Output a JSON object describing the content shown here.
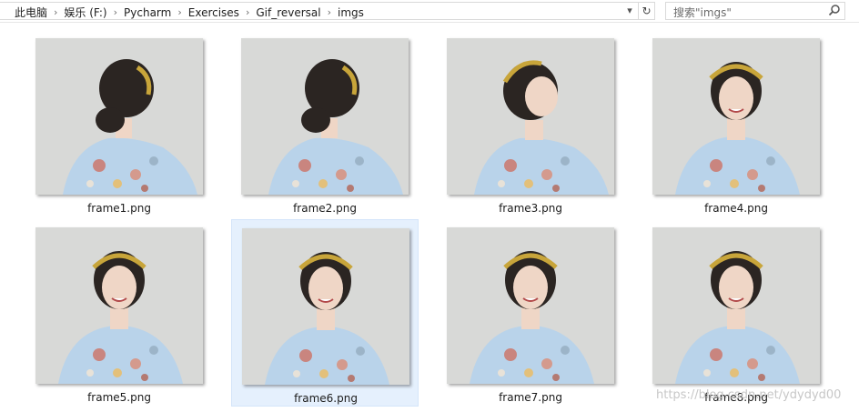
{
  "breadcrumbs": [
    "此电脑",
    "娱乐 (F:)",
    "Pycharm",
    "Exercises",
    "Gif_reversal",
    "imgs"
  ],
  "search": {
    "placeholder": "搜索\"imgs\""
  },
  "files": [
    {
      "name": "frame1.png",
      "pose": "back",
      "selected": false
    },
    {
      "name": "frame2.png",
      "pose": "back",
      "selected": false
    },
    {
      "name": "frame3.png",
      "pose": "turn",
      "selected": false
    },
    {
      "name": "frame4.png",
      "pose": "front",
      "selected": false
    },
    {
      "name": "frame5.png",
      "pose": "front",
      "selected": false
    },
    {
      "name": "frame6.png",
      "pose": "front",
      "selected": true
    },
    {
      "name": "frame7.png",
      "pose": "front",
      "selected": false
    },
    {
      "name": "frame8.png",
      "pose": "front",
      "selected": false
    }
  ],
  "watermark": "https://blog.csdn.net/ydydyd00",
  "colors": {
    "thumb_bg": "#d8d9d7",
    "selection": "#e5f0fd",
    "dress": "#b9d3ea",
    "hair": "#2b2522",
    "skin": "#efd6c6",
    "headband": "#c8a53a"
  },
  "icons": {
    "dropdown": "chevron-down-icon",
    "refresh": "refresh-icon",
    "search": "search-icon"
  }
}
